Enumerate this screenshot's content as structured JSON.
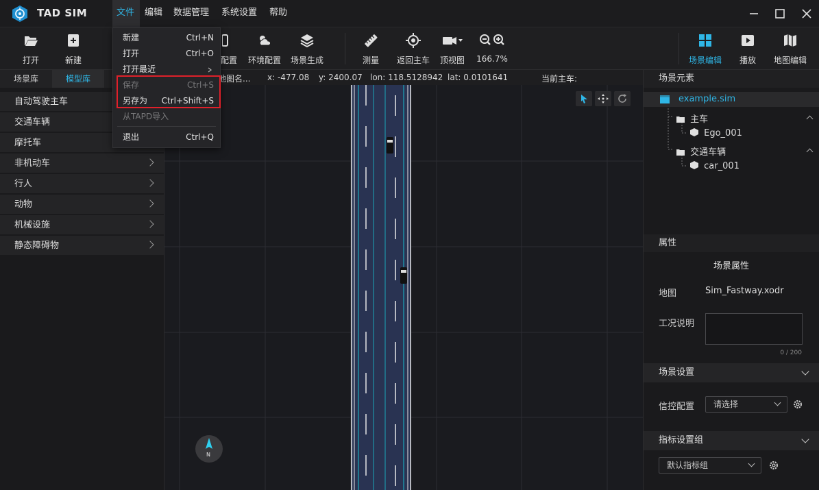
{
  "app": {
    "name": "TAD SIM"
  },
  "colors": {
    "accent": "#2fb6e6",
    "highlight": "#e0202a",
    "road": "#293352",
    "lane_line_cyan": "#1aa6b8"
  },
  "menubar": {
    "file": "文件",
    "edit": "编辑",
    "data": "数据管理",
    "settings": "系统设置",
    "help": "帮助"
  },
  "file_menu": {
    "new": {
      "label": "新建",
      "shortcut": "Ctrl+N"
    },
    "open": {
      "label": "打开",
      "shortcut": "Ctrl+O"
    },
    "recent": {
      "label": "打开最近"
    },
    "save": {
      "label": "保存",
      "shortcut": "Ctrl+S"
    },
    "save_as": {
      "label": "另存为",
      "shortcut": "Ctrl+Shift+S"
    },
    "import_tapd": {
      "label": "从TAPD导入"
    },
    "exit": {
      "label": "退出",
      "shortcut": "Ctrl+Q"
    }
  },
  "toolbar": {
    "open": "打开",
    "new": "新建",
    "config_partial": "配置",
    "env_config": "环境配置",
    "scene_gen": "场景生成",
    "measure": "测量",
    "back_to_ego": "返回主车",
    "top_view": "顶视图",
    "zoom": "166.7%",
    "scene_edit": "场景编辑",
    "play": "播放",
    "map_edit": "地图编辑"
  },
  "left_panel": {
    "tabs": [
      "场景库",
      "模型库"
    ],
    "categories": [
      "自动驾驶主车",
      "交通车辆",
      "摩托车",
      "非机动车",
      "行人",
      "动物",
      "机械设施",
      "静态障碍物"
    ]
  },
  "coords": {
    "map_name": "地图名...",
    "x": "x: -477.08",
    "y": "y: 2400.07",
    "lon": "lon: 118.5128942",
    "lat": "lat: 0.0101641",
    "ego": "当前主车:"
  },
  "compass": {
    "label": "N"
  },
  "scene_elements": {
    "title": "场景元素",
    "file": "example.sim",
    "ego_group": "主车",
    "ego_item": "Ego_001",
    "traffic_group": "交通车辆",
    "traffic_item": "car_001"
  },
  "properties": {
    "title": "属性",
    "subtitle": "场景属性",
    "map_label": "地图",
    "map_value": "Sim_Fastway.xodr",
    "desc_label": "工况说明",
    "desc_counter": "0 / 200",
    "scene_settings": "场景设置",
    "signal_label": "信控配置",
    "signal_placeholder": "请选择",
    "metrics_group": "指标设置组",
    "metrics_value": "默认指标组"
  }
}
